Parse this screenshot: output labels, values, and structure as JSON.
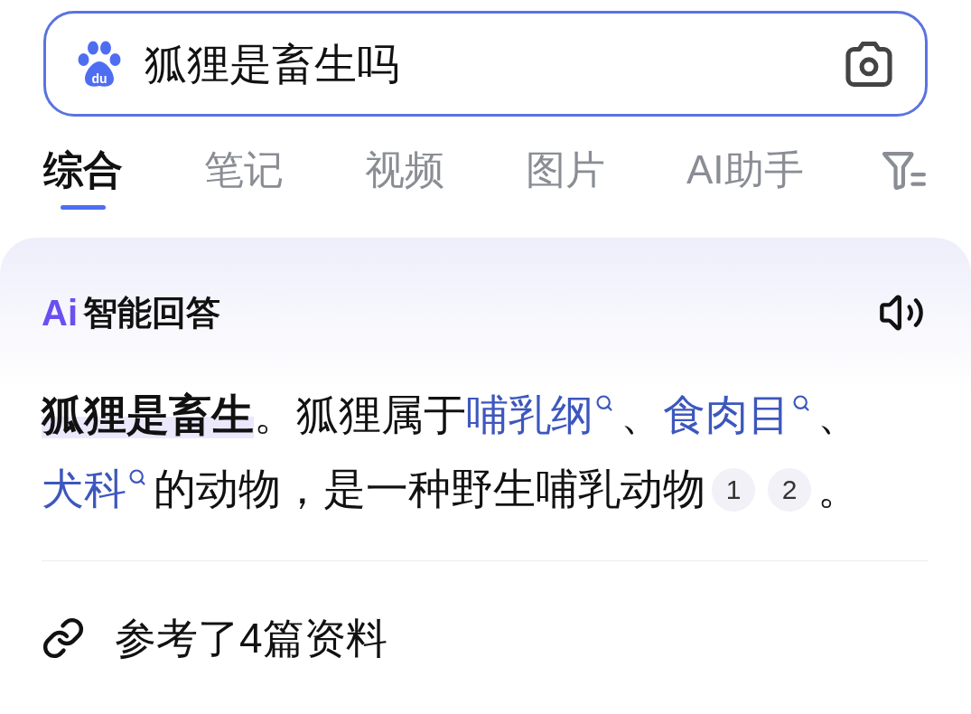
{
  "search_bar": {
    "logo_text": "du",
    "query": "狐狸是畜生吗"
  },
  "tabs": [
    {
      "label": "综合",
      "selected": true
    },
    {
      "label": "笔记",
      "selected": false
    },
    {
      "label": "视频",
      "selected": false
    },
    {
      "label": "图片",
      "selected": false
    },
    {
      "label": "AI助手",
      "selected": false
    }
  ],
  "ai_answer": {
    "badge": "Ai",
    "title": "智能回答",
    "segments": [
      {
        "kind": "bold",
        "text": "狐狸是畜生"
      },
      {
        "kind": "text",
        "text": "。狐狸属于"
      },
      {
        "kind": "link",
        "text": "哺乳纲"
      },
      {
        "kind": "text",
        "text": "、"
      },
      {
        "kind": "link",
        "text": "食肉目"
      },
      {
        "kind": "text",
        "text": "、"
      },
      {
        "kind": "link",
        "text": "犬科"
      },
      {
        "kind": "text",
        "text": "的动物，是一种野生哺乳动物"
      },
      {
        "kind": "citation",
        "text": "1"
      },
      {
        "kind": "citation",
        "text": "2"
      },
      {
        "kind": "text",
        "text": "。"
      }
    ],
    "references": "参考了4篇资料"
  }
}
